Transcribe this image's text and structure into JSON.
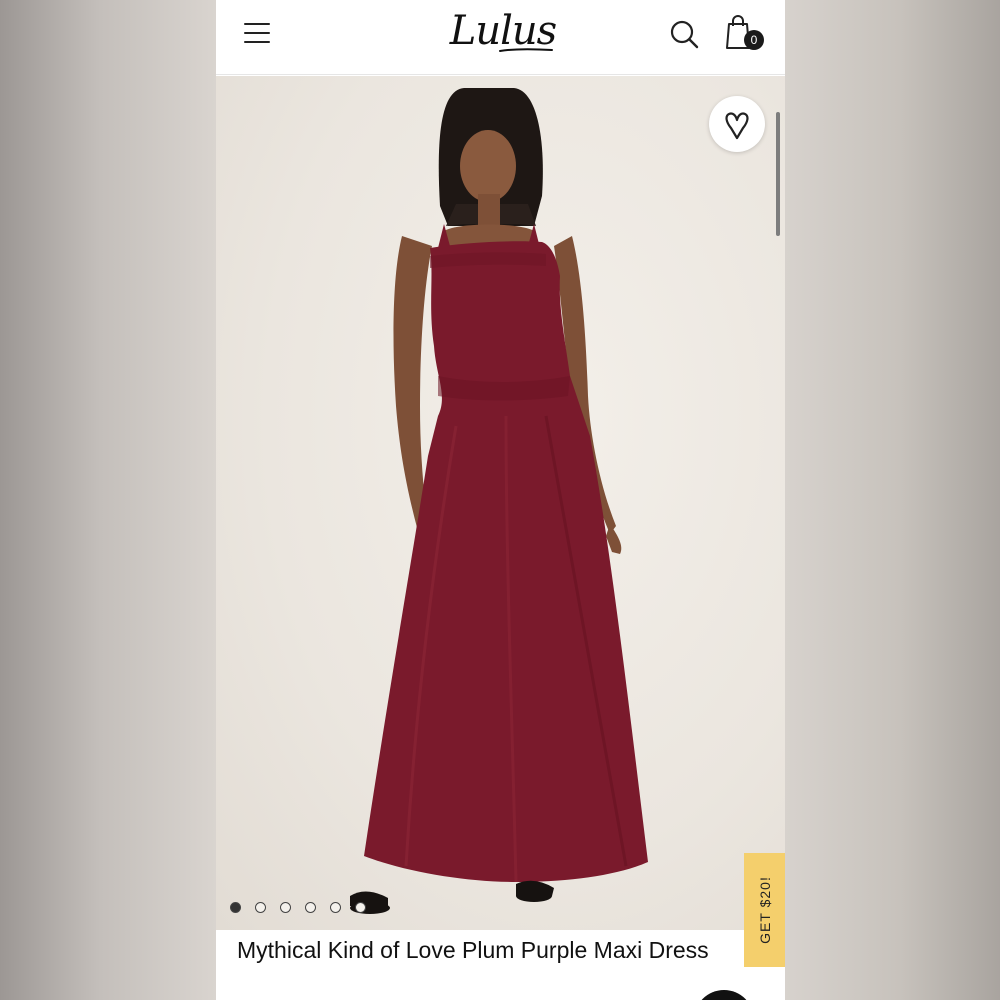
{
  "header": {
    "brand": "Lulus",
    "cart_count": "0"
  },
  "gallery": {
    "image_alt": "Model wearing plum purple maxi dress",
    "dress_color": "#7a1a2c",
    "slide_count": 6,
    "active_slide": 1
  },
  "promo": {
    "label": "GET $20!",
    "color": "#f4cf6c"
  },
  "product": {
    "title": "Mythical Kind of Love Plum Purple Maxi Dress"
  },
  "icons": {
    "menu": "hamburger-icon",
    "search": "search-icon",
    "cart": "shopping-bag-icon",
    "wishlist": "heart-icon"
  }
}
